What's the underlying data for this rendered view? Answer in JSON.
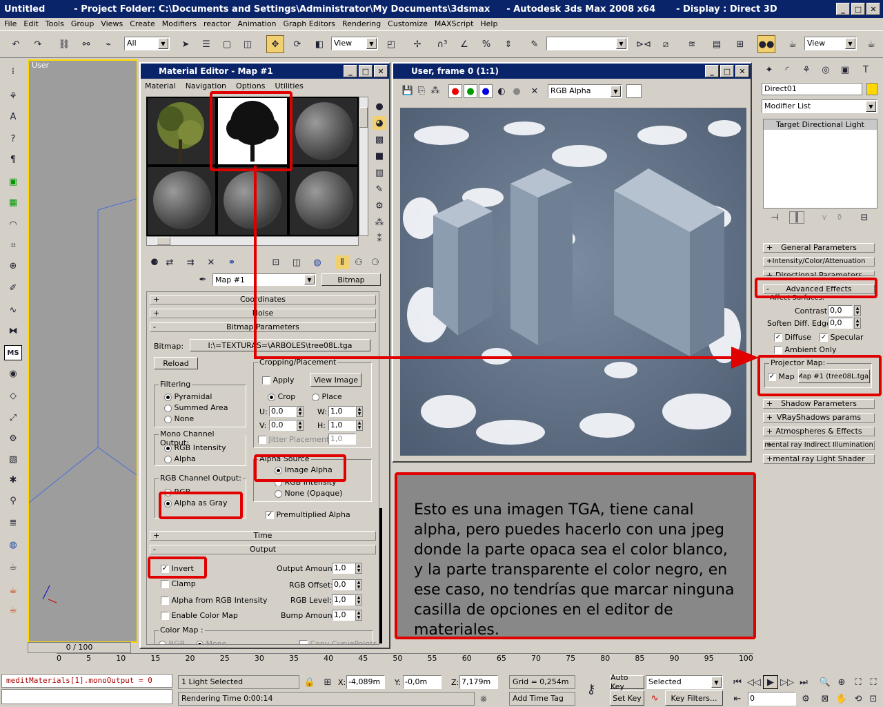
{
  "titlebar": {
    "app": "Untitled",
    "project": "- Project Folder: C:\\Documents and Settings\\Administrator\\My Documents\\3dsmax",
    "product": "- Autodesk 3ds Max 2008 x64",
    "display": "- Display : Direct 3D"
  },
  "menu": [
    "File",
    "Edit",
    "Tools",
    "Group",
    "Views",
    "Create",
    "Modifiers",
    "reactor",
    "Animation",
    "Graph Editors",
    "Rendering",
    "Customize",
    "MAXScript",
    "Help"
  ],
  "toolbar": {
    "selection_filter": "All",
    "ref_coord": "View",
    "ref_coord2": "View"
  },
  "viewport": {
    "label": "User"
  },
  "material_editor": {
    "title": "Material Editor - Map #1",
    "menu": [
      "Material",
      "Navigation",
      "Options",
      "Utilities"
    ],
    "map_name": "Map #1",
    "map_type": "Bitmap",
    "rollouts": {
      "coordinates": "Coordinates",
      "noise": "Noise",
      "bitmap_params": "Bitmap Parameters",
      "time": "Time",
      "output": "Output"
    },
    "bitmap": {
      "label": "Bitmap:",
      "path": "I:\\=TEXTURAS=\\ARBOLES\\tree08L.tga",
      "reload": "Reload"
    },
    "filtering": {
      "title": "Filtering",
      "options": [
        "Pyramidal",
        "Summed Area",
        "None"
      ],
      "selected": "Pyramidal"
    },
    "mono": {
      "title": "Mono Channel Output:",
      "options": [
        "RGB Intensity",
        "Alpha"
      ],
      "selected": "RGB Intensity"
    },
    "rgb": {
      "title": "RGB Channel Output:",
      "options": [
        "RGB",
        "Alpha as Gray"
      ],
      "selected": "Alpha as Gray"
    },
    "crop": {
      "title": "Cropping/Placement",
      "apply": "Apply",
      "view_image": "View Image",
      "crop": "Crop",
      "place": "Place",
      "u_label": "U:",
      "u": "0,0",
      "w_label": "W:",
      "w": "1,0",
      "v_label": "V:",
      "v": "0,0",
      "h_label": "H:",
      "h": "1,0",
      "jitter": "Jitter Placement:",
      "jitter_val": "1,0"
    },
    "alpha_source": {
      "title": "Alpha Source",
      "options": [
        "Image Alpha",
        "RGB Intensity",
        "None (Opaque)"
      ],
      "selected": "Image Alpha",
      "premult": "Premultiplied Alpha"
    },
    "output": {
      "invert": "Invert",
      "clamp": "Clamp",
      "alpha_from_rgb": "Alpha from RGB Intensity",
      "enable_color_map": "Enable Color Map",
      "output_amount_label": "Output Amount:",
      "output_amount": "1,0",
      "rgb_offset_label": "RGB Offset:",
      "rgb_offset": "0,0",
      "rgb_level_label": "RGB Level:",
      "rgb_level": "1,0",
      "bump_amount_label": "Bump Amount:",
      "bump_amount": "1,0",
      "color_map": "Color Map :",
      "rgb_opt": "RGB",
      "mono_opt": "Mono",
      "copy_curve": "Copy CurvePoints"
    }
  },
  "render_window": {
    "title": "User, frame 0 (1:1)",
    "channel": "RGB Alpha"
  },
  "note": "Esto es una imagen TGA, tiene canal alpha, pero puedes hacerlo con una jpeg donde la parte opaca sea el color blanco, y la parte transparente el color negro, en ese caso, no tendrías que marcar ninguna casilla de opciones en el editor de materiales.",
  "command_panel": {
    "object_name": "Direct01",
    "modifier_list": "Modifier List",
    "stack_item": "Target Directional Light",
    "rollouts": [
      "General Parameters",
      "Intensity/Color/Attenuation",
      "Directional Parameters",
      "Advanced Effects"
    ],
    "affect_surfaces": "Affect Surfaces:",
    "contrast_label": "Contrast:",
    "contrast": "0,0",
    "soften_label": "Soften Diff. Edge:",
    "soften": "0,0",
    "diffuse": "Diffuse",
    "specular": "Specular",
    "ambient_only": "Ambient Only",
    "projector_title": "Projector Map:",
    "projector_map": "Map",
    "projector_btn": "Map #1 (tree08L.tga)",
    "rollouts2": [
      "Shadow Parameters",
      "VRayShadows params",
      "Atmospheres & Effects",
      "mental ray Indirect Illumination",
      "mental ray Light Shader"
    ]
  },
  "timeline": {
    "frame": "0 / 100",
    "ticks": [
      "0",
      "5",
      "10",
      "15",
      "20",
      "25",
      "30",
      "35",
      "40",
      "45",
      "50",
      "55",
      "60",
      "65",
      "70",
      "75",
      "80",
      "85",
      "90",
      "95",
      "100"
    ]
  },
  "status": {
    "script": "meditMaterials[1].monoOutput = 0",
    "selected": "1 Light Selected",
    "render_time": "Rendering Time  0:00:14",
    "x_label": "X:",
    "x": "-4,089m",
    "y_label": "Y:",
    "y": "-0,0m",
    "z_label": "Z:",
    "z": "7,179m",
    "grid": "Grid = 0,254m",
    "add_tag": "Add Time Tag",
    "auto_key": "Auto Key",
    "set_key": "Set Key",
    "selected_set": "Selected",
    "key_filters": "Key Filters...",
    "frame_field": "0"
  }
}
